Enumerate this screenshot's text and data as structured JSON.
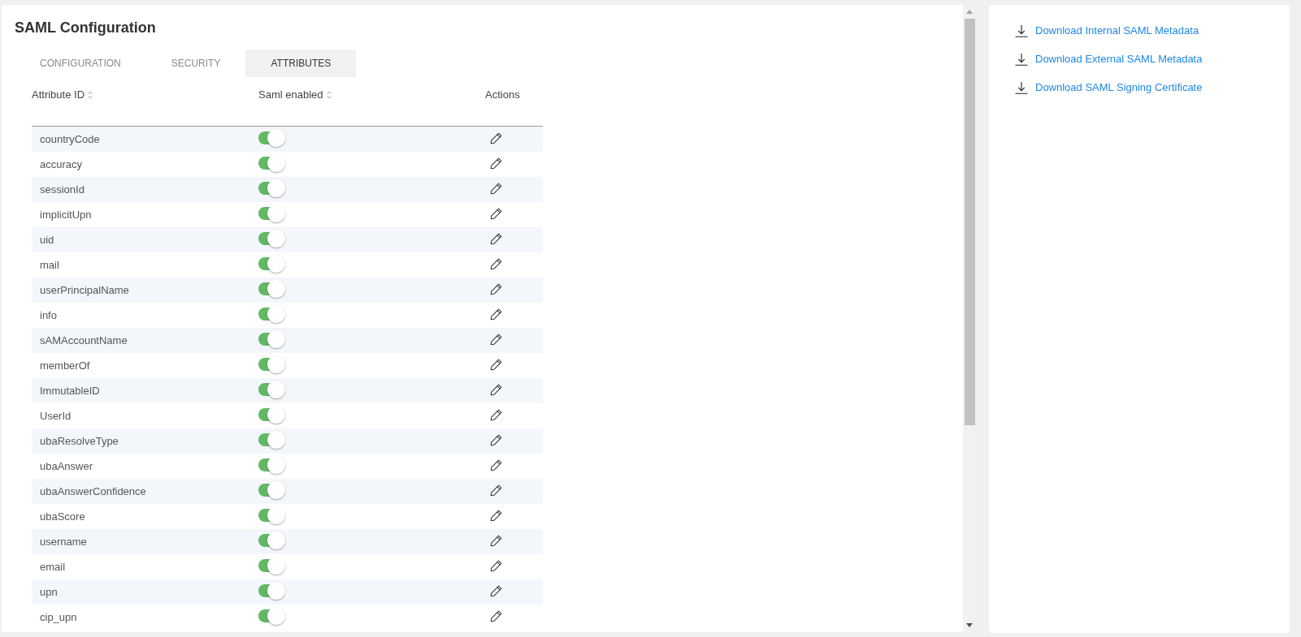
{
  "title": "SAML Configuration",
  "tabs": [
    {
      "label": "CONFIGURATION",
      "selected": false
    },
    {
      "label": "SECURITY",
      "selected": false
    },
    {
      "label": "ATTRIBUTES",
      "selected": true
    }
  ],
  "table": {
    "columns": [
      {
        "label": "Attribute ID",
        "sortable": true
      },
      {
        "label": "Saml enabled",
        "sortable": true
      },
      {
        "label": "Actions",
        "sortable": false
      }
    ],
    "rows": [
      {
        "attribute_id": "countryCode",
        "saml_enabled": true
      },
      {
        "attribute_id": "accuracy",
        "saml_enabled": true
      },
      {
        "attribute_id": "sessionId",
        "saml_enabled": true
      },
      {
        "attribute_id": "implicitUpn",
        "saml_enabled": true
      },
      {
        "attribute_id": "uid",
        "saml_enabled": true
      },
      {
        "attribute_id": "mail",
        "saml_enabled": true
      },
      {
        "attribute_id": "userPrincipalName",
        "saml_enabled": true
      },
      {
        "attribute_id": "info",
        "saml_enabled": true
      },
      {
        "attribute_id": "sAMAccountName",
        "saml_enabled": true
      },
      {
        "attribute_id": "memberOf",
        "saml_enabled": true
      },
      {
        "attribute_id": "ImmutableID",
        "saml_enabled": true
      },
      {
        "attribute_id": "UserId",
        "saml_enabled": true
      },
      {
        "attribute_id": "ubaResolveType",
        "saml_enabled": true
      },
      {
        "attribute_id": "ubaAnswer",
        "saml_enabled": true
      },
      {
        "attribute_id": "ubaAnswerConfidence",
        "saml_enabled": true
      },
      {
        "attribute_id": "ubaScore",
        "saml_enabled": true
      },
      {
        "attribute_id": "username",
        "saml_enabled": true
      },
      {
        "attribute_id": "email",
        "saml_enabled": true
      },
      {
        "attribute_id": "upn",
        "saml_enabled": true
      },
      {
        "attribute_id": "cip_upn",
        "saml_enabled": true
      }
    ]
  },
  "sidebar": {
    "links": [
      {
        "label": "Download Internal SAML Metadata"
      },
      {
        "label": "Download External SAML Metadata"
      },
      {
        "label": "Download SAML Signing Certificate"
      }
    ]
  }
}
